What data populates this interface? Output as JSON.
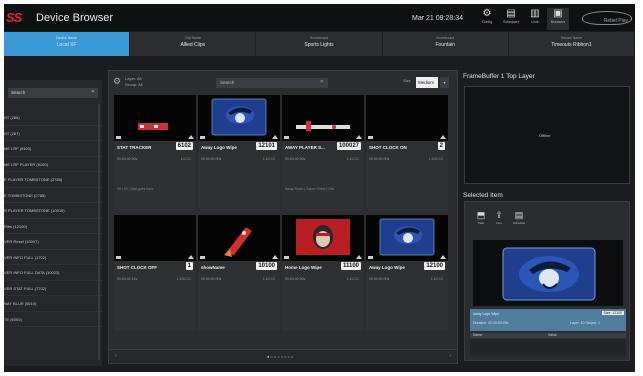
{
  "header": {
    "logo": "SS",
    "title": "Device Browser",
    "datetime": "Mar 21 09:28:34",
    "icons": [
      {
        "name": "gear-icon",
        "glyph": "⚙",
        "label": "Config"
      },
      {
        "name": "clipboard-icon",
        "glyph": "▤",
        "label": "Scheduler"
      },
      {
        "name": "list-icon",
        "glyph": "▥",
        "label": "Lists"
      },
      {
        "name": "monitor-icon",
        "glyph": "▣",
        "label": "Browsers"
      }
    ],
    "brand": "Rebel Play"
  },
  "tabs": [
    {
      "caption": "Device Name",
      "value": "Local XF"
    },
    {
      "caption": "Clip Name",
      "value": "Allied Clips"
    },
    {
      "caption": "Scoreboard",
      "value": "Sports Lights"
    },
    {
      "caption": "Scoreboard",
      "value": "Fountain"
    },
    {
      "caption": "Stream Name",
      "value": "Timeouts Ribbon1"
    }
  ],
  "sidebar": {
    "search_placeholder": "Search",
    "items": [
      "NT (286)",
      "NT (287)",
      "ME LRF (6100)",
      "ME LRF PLAYER (6100)",
      "E PLAYER TOMBSTONE (2788)",
      "E TOMBSTONE (2788)",
      "R PLAYER TOMBSTONE (10019)",
      "Ribs (12100)",
      "VER Reset (10007)",
      "VER INFO FULL (1702)",
      "VER INFO FULL DATA (10023)",
      "VER STAT FULL (7702)",
      "NAY BLUR (5010)",
      "TE (6000)"
    ]
  },
  "grid": {
    "layer": "Layer: All",
    "group": "Group: All",
    "search_placeholder": "Search",
    "size_label": "Size",
    "size_value": "Medium",
    "cards": [
      {
        "title": "STAT TRACKER",
        "number": "6102",
        "duration": "00:00:02:00s",
        "loop": "L:0  C1",
        "desc": "00 | 00 | Stat goes here",
        "thumb": "truck"
      },
      {
        "title": "Away Logo Wipe",
        "number": "12101",
        "duration": "00:00:02:00s",
        "loop": "L:10  C1",
        "desc": "",
        "thumb": "away"
      },
      {
        "title": "AWAY PLAYER S...",
        "number": "100027",
        "duration": "00:00:02:00s",
        "loop": "L:10  C1",
        "desc": "Away:Team | Game Sheet | Sta",
        "thumb": "bar"
      },
      {
        "title": "SHOT CLOCK ON",
        "number": "2",
        "duration": "00:00:02:00s",
        "loop": "L:100  C1",
        "desc": "",
        "thumb": "black"
      },
      {
        "title": "SHOT CLOCK OFF",
        "number": "1",
        "duration": "00:00:02:12s",
        "loop": "L:100  C1",
        "desc": "",
        "thumb": "black"
      },
      {
        "title": "showName",
        "number": "10100",
        "duration": "00:00:02:00s",
        "loop": "L:10  C1",
        "desc": "",
        "thumb": "rocket"
      },
      {
        "title": "Home Logo Wipe",
        "number": "11100",
        "duration": "00:00:02:00s",
        "loop": "L:10  C1",
        "desc": "",
        "thumb": "home"
      },
      {
        "title": "Away Logo Wipe",
        "number": "12100",
        "duration": "00:00:02:00s",
        "loop": "L:10  C1",
        "desc": "",
        "thumb": "away"
      }
    ],
    "pager_dots": "●○○○○○○○"
  },
  "framebuffer": {
    "title": "FrameBuffer 1 Top Layer",
    "status": "Offline"
  },
  "selected": {
    "title": "Selected Item",
    "actions": [
      {
        "name": "take-icon",
        "glyph": "⬒",
        "label": "Take"
      },
      {
        "name": "cue-icon",
        "glyph": "⇪",
        "label": "Cue"
      },
      {
        "name": "schedule-icon",
        "glyph": "▤",
        "label": "Schedule"
      }
    ],
    "item_name": "Away Logo Wipe",
    "badge": "Size: 12100",
    "duration": "Duration: 00:00:02:00s",
    "layer": "Layer: 10    Output: 1",
    "kv_key": "Name",
    "kv_value": "Value"
  }
}
